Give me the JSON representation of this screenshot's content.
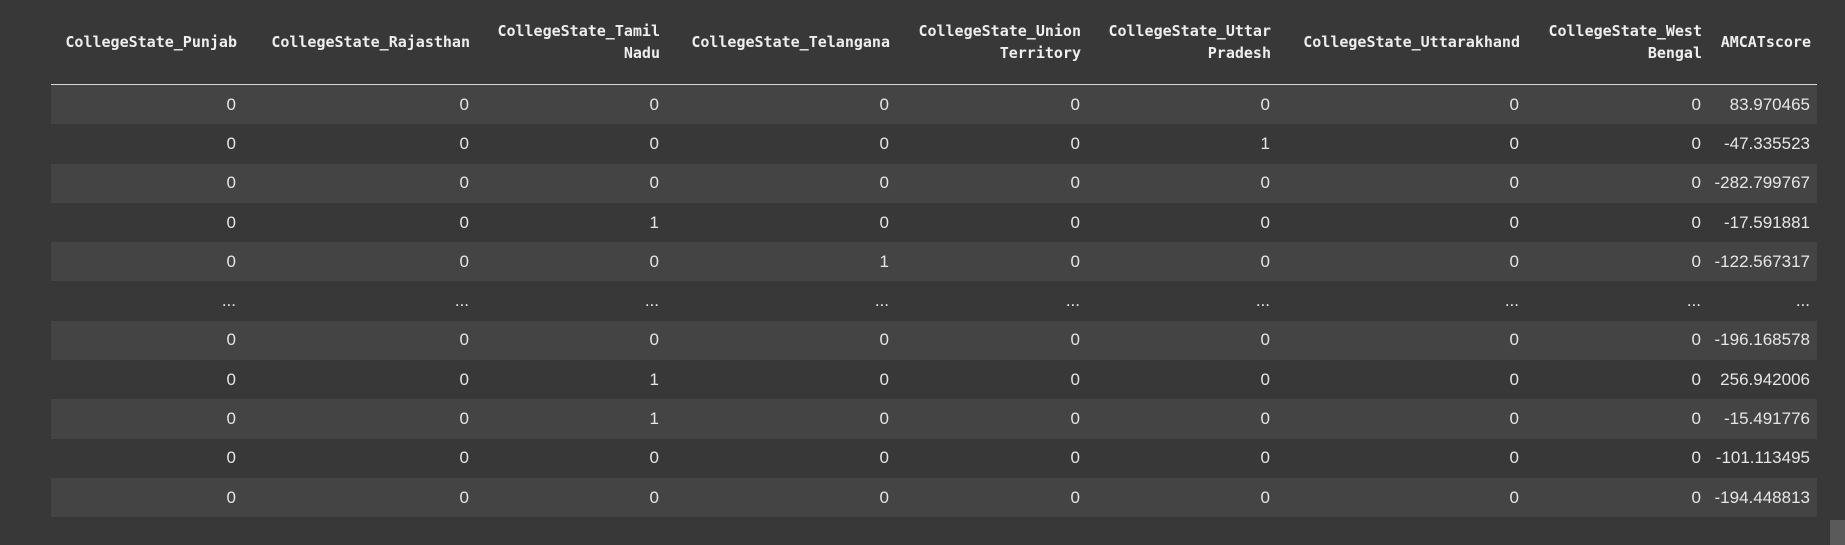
{
  "table": {
    "columns": [
      "CollegeState_Punjab",
      "CollegeState_Rajasthan",
      "CollegeState_Tamil Nadu",
      "CollegeState_Telangana",
      "CollegeState_Union Territory",
      "CollegeState_Uttar Pradesh",
      "CollegeState_Uttarakhand",
      "CollegeState_West Bengal",
      "AMCATscore"
    ],
    "rows": [
      [
        "0",
        "0",
        "0",
        "0",
        "0",
        "0",
        "0",
        "0",
        "83.970465"
      ],
      [
        "0",
        "0",
        "0",
        "0",
        "0",
        "1",
        "0",
        "0",
        "-47.335523"
      ],
      [
        "0",
        "0",
        "0",
        "0",
        "0",
        "0",
        "0",
        "0",
        "-282.799767"
      ],
      [
        "0",
        "0",
        "1",
        "0",
        "0",
        "0",
        "0",
        "0",
        "-17.591881"
      ],
      [
        "0",
        "0",
        "0",
        "1",
        "0",
        "0",
        "0",
        "0",
        "-122.567317"
      ],
      [
        "...",
        "...",
        "...",
        "...",
        "...",
        "...",
        "...",
        "...",
        "..."
      ],
      [
        "0",
        "0",
        "0",
        "0",
        "0",
        "0",
        "0",
        "0",
        "-196.168578"
      ],
      [
        "0",
        "0",
        "1",
        "0",
        "0",
        "0",
        "0",
        "0",
        "256.942006"
      ],
      [
        "0",
        "0",
        "1",
        "0",
        "0",
        "0",
        "0",
        "0",
        "-15.491776"
      ],
      [
        "0",
        "0",
        "0",
        "0",
        "0",
        "0",
        "0",
        "0",
        "-101.113495"
      ],
      [
        "0",
        "0",
        "0",
        "0",
        "0",
        "0",
        "0",
        "0",
        "-194.448813"
      ]
    ]
  }
}
